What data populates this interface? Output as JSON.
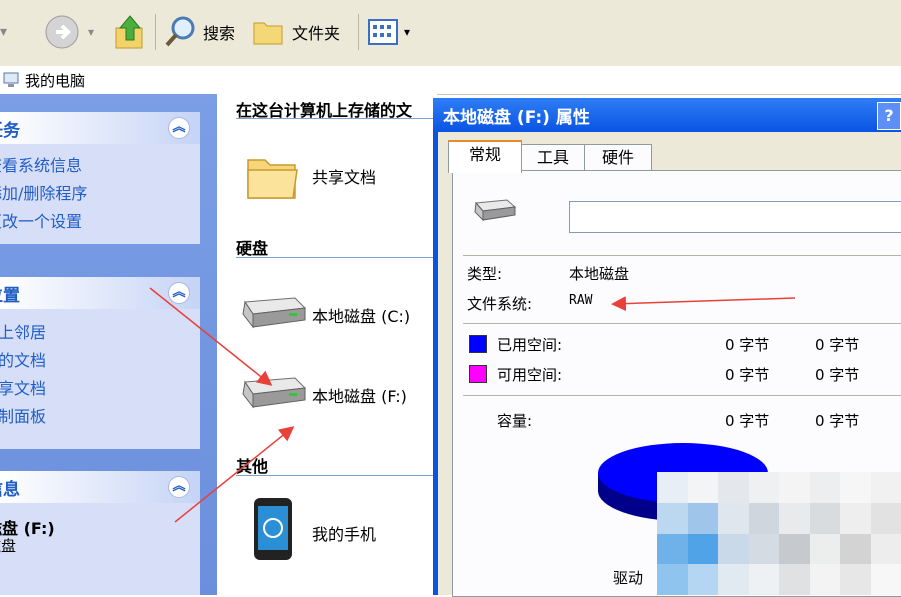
{
  "toolbar": {
    "search_label": "搜索",
    "folders_label": "文件夹"
  },
  "address": {
    "text": "我的电脑"
  },
  "sidebar": {
    "tasks": {
      "title": "任务",
      "items": [
        "查看系统信息",
        "添加/删除程序",
        "更改一个设置"
      ]
    },
    "places": {
      "title": "位置",
      "items": [
        "网上邻居",
        "我的文档",
        "共享文档",
        "控制面板"
      ]
    },
    "details": {
      "title": "信息",
      "name": "磁盘 (F:)",
      "type": "磁盘"
    }
  },
  "main": {
    "header": "在这台计算机上存储的文",
    "shared_docs": "共享文档",
    "group_hdd": "硬盘",
    "drive_c": "本地磁盘 (C:)",
    "drive_f": "本地磁盘 (F:)",
    "group_other": "其他",
    "phone": "我的手机"
  },
  "dialog": {
    "title": "本地磁盘 (F:) 属性",
    "help": "?",
    "tabs": [
      "常规",
      "工具",
      "硬件"
    ],
    "type_label": "类型:",
    "type_value": "本地磁盘",
    "fs_label": "文件系统:",
    "fs_value": "RAW",
    "used_label": "已用空间:",
    "used_bytes": "0 字节",
    "used_size": "0 字节",
    "free_label": "可用空间:",
    "free_bytes": "0 字节",
    "free_size": "0 字节",
    "capacity_label": "容量:",
    "capacity_bytes": "0 字节",
    "capacity_size": "0 字节",
    "drive_label": "驱动"
  },
  "colors": {
    "used_swatch": "#0000ff",
    "free_swatch": "#ff00ff",
    "annotation_arrow": "#e8413a",
    "sidebar_blue": "#215dc6"
  }
}
